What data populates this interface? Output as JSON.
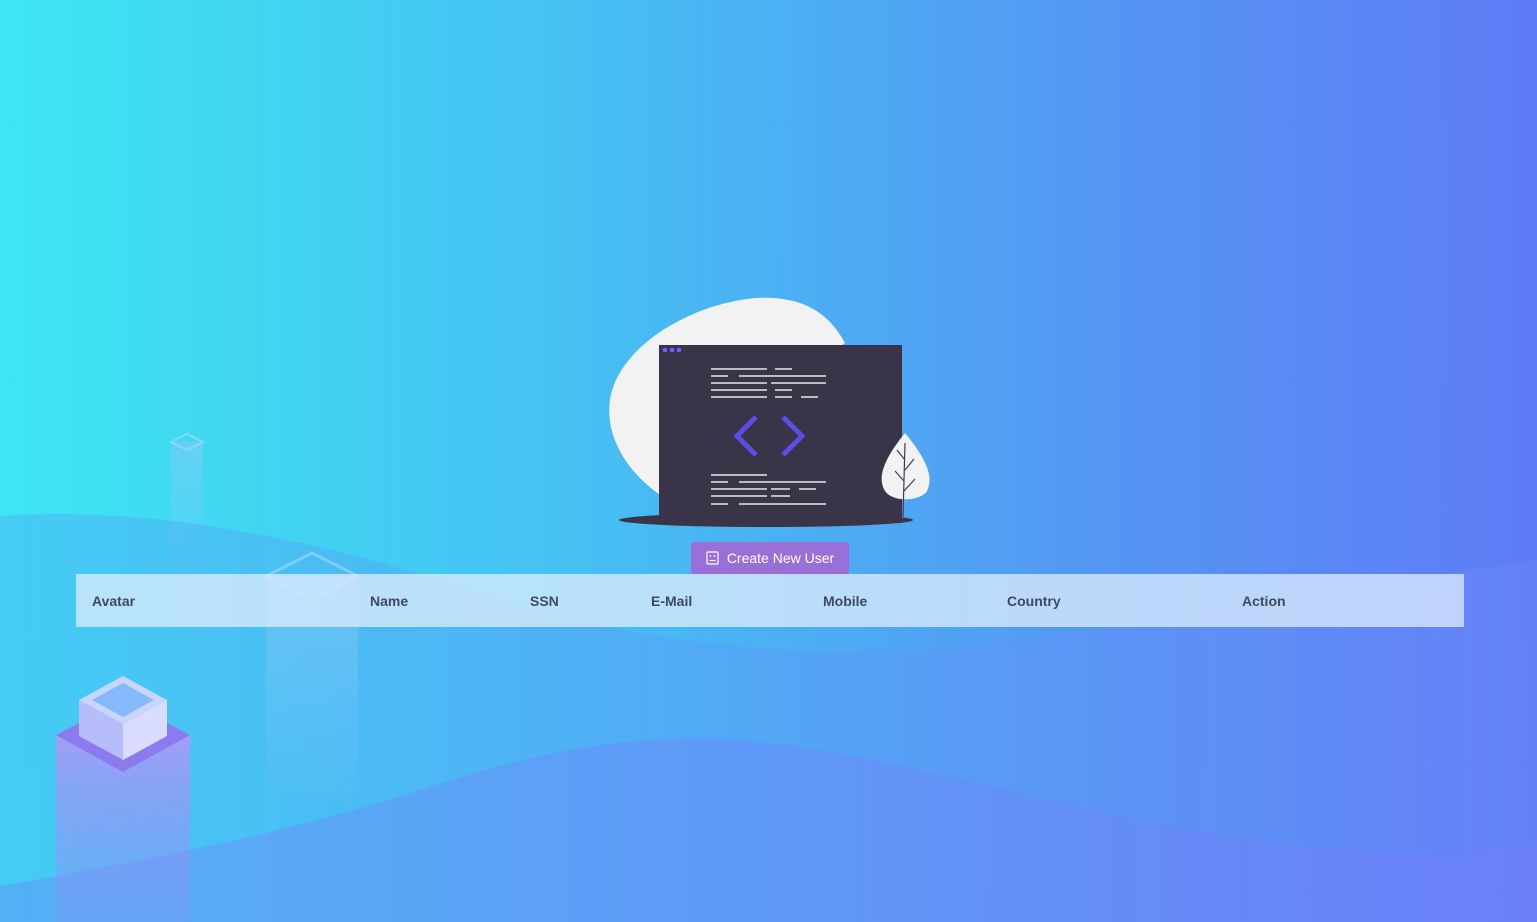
{
  "actions": {
    "create_label": "Create New User",
    "create_icon": "user-card-icon"
  },
  "table": {
    "columns": [
      "Avatar",
      "Name",
      "SSN",
      "E-Mail",
      "Mobile",
      "Country",
      "Action"
    ],
    "rows": []
  },
  "theme": {
    "gradient_start": "#3de6f2",
    "gradient_end": "#5f7bf6",
    "button_color": "#9b6fd8",
    "accent_code": "#5a4de8",
    "screen_dark": "#3a3448"
  }
}
